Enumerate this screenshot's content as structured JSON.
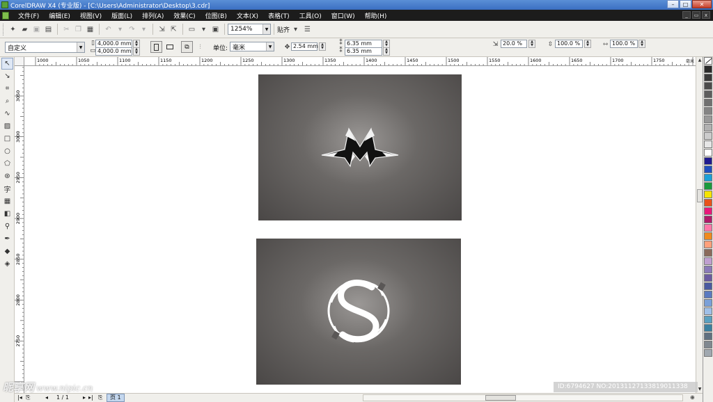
{
  "window": {
    "title": "CorelDRAW X4 (专业版) - [C:\\Users\\Administrator\\Desktop\\3.cdr]",
    "controls": [
      "–",
      "□",
      "✕"
    ]
  },
  "menu": [
    "文件(F)",
    "编辑(E)",
    "视图(V)",
    "版面(L)",
    "排列(A)",
    "效果(C)",
    "位图(B)",
    "文本(X)",
    "表格(T)",
    "工具(O)",
    "窗口(W)",
    "帮助(H)"
  ],
  "toolbar": {
    "zoom": "1254%",
    "snap_label": "贴齐"
  },
  "propbar": {
    "page_preset": "自定义",
    "page_width": "4,000.0 mm",
    "page_height": "4,000.0 mm",
    "unit_label": "单位:",
    "unit_value": "毫米",
    "nudge": "2.54 mm",
    "dup_x": "6.35 mm",
    "dup_y": "6.35 mm",
    "scale_a": "20.0 %",
    "scale_b": "100.0 %",
    "scale_c": "100.0 %"
  },
  "rulers": {
    "h_ticks": [
      "1000",
      "1050",
      "1100",
      "1150",
      "1200",
      "1250",
      "1300",
      "1350",
      "1400",
      "1450",
      "1500",
      "1550",
      "1600",
      "1650",
      "1700",
      "1750"
    ],
    "v_ticks": [
      "3050",
      "3000",
      "2950",
      "2900",
      "2850",
      "2800",
      "2750"
    ],
    "unit": "毫米"
  },
  "artboards": [
    {
      "logo": "M",
      "shape": "stylized-crown-M"
    },
    {
      "logo": "S",
      "shape": "circular-S-emblem"
    }
  ],
  "palette": [
    "#2a2a2a",
    "#3a3a3a",
    "#4b4b4b",
    "#5d5d5d",
    "#707070",
    "#848484",
    "#999999",
    "#b1b1b1",
    "#cccccc",
    "#e6e6e6",
    "#ffffff",
    "#1f1a8f",
    "#1f4fbf",
    "#1aa0d8",
    "#1a9a3c",
    "#f5e400",
    "#e8531a",
    "#e8197a",
    "#b01a6a",
    "#ff77a8",
    "#f08a1e",
    "#ffa07a",
    "#8a6a5a",
    "#c0a0d0",
    "#8a7ab8",
    "#6a5aa0",
    "#4a5aa0",
    "#5a7ac0",
    "#7aa0d8",
    "#a0c0e8",
    "#5aa0c0",
    "#3a80a0",
    "#607080",
    "#808890",
    "#a0a8b0"
  ],
  "status": {
    "page_counter": "1 / 1",
    "page_tab": "页 1"
  },
  "watermark": {
    "brand": "昵享网",
    "url": "www.nipic.cn",
    "id": "ID:6794627 NO:20131127133819011338"
  }
}
